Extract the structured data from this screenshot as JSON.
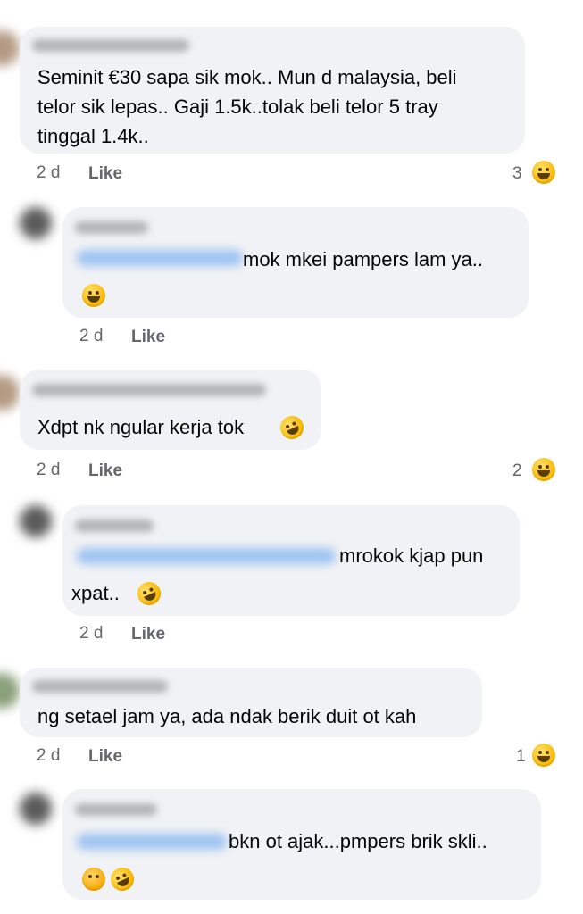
{
  "comments": [
    {
      "text_lines": [
        "Seminit €30 sapa sik mok.. Mun d malaysia, beli",
        "telor sik lepas.. Gaji 1.5k..tolak beli telor   5 tray",
        "tinggal 1.4k.."
      ],
      "time": "2 d",
      "like": "Like",
      "reaction_count": "3",
      "reaction": "laughing-emoji"
    },
    {
      "mention_suffix": "mok mkei pampers lam ya..",
      "time": "2 d",
      "like": "Like",
      "emoji": "sweat-smile-emoji"
    },
    {
      "text": "Xdpt nk ngular kerja tok",
      "time": "2 d",
      "like": "Like",
      "reaction_count": "2",
      "reaction": "laughing-emoji"
    },
    {
      "mention_suffix": "mrokok kjap pun",
      "line2": "xpat..",
      "time": "2 d",
      "like": "Like"
    },
    {
      "text": "ng setael jam ya, ada ndak berik duit ot kah",
      "time": "2 d",
      "like": "Like",
      "reaction_count": "1",
      "reaction": "laughing-emoji"
    },
    {
      "mention_suffix": "bkn ot ajak...pmpers brik skli..",
      "emojis": [
        "hand-over-mouth-emoji",
        "rofl-emoji"
      ]
    }
  ]
}
